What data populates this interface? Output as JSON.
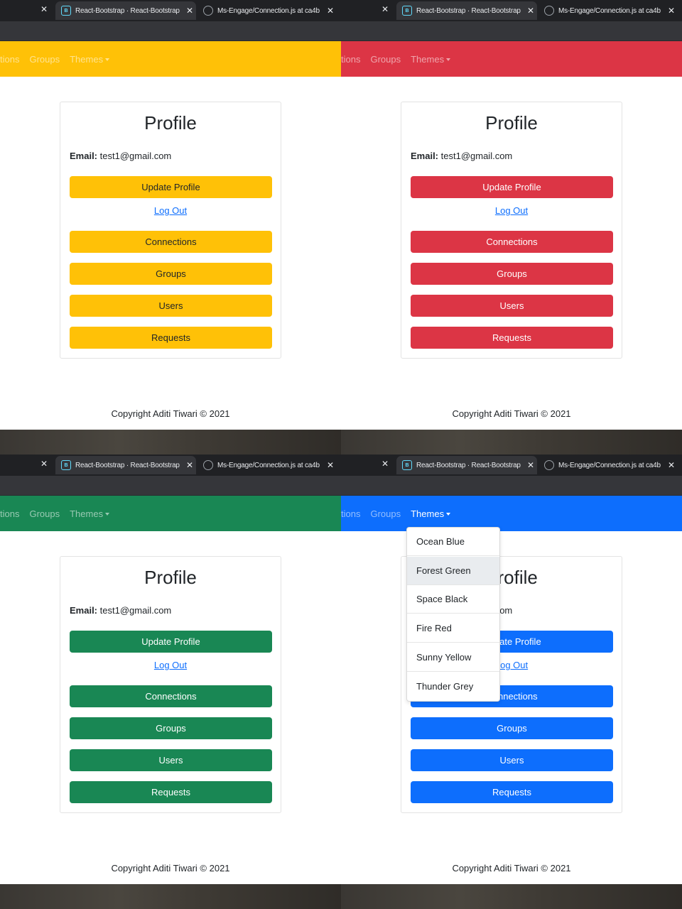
{
  "browser": {
    "tab1_title": "React-Bootstrap · React-Bootstrap",
    "tab2_title": "Ms-Engage/Connection.js at ca4b",
    "tab1_favicon": "react-bootstrap-icon",
    "tab2_favicon": "github-icon"
  },
  "nav": {
    "link_connections": "tions",
    "link_groups": "Groups",
    "link_themes": "Themes"
  },
  "profile": {
    "title": "Profile",
    "email_label": "Email:",
    "email_value": "test1@gmail.com",
    "update_button": "Update Profile",
    "logout_link": "Log Out",
    "connections_button": "Connections",
    "groups_button": "Groups",
    "users_button": "Users",
    "requests_button": "Requests"
  },
  "footer": {
    "copyright": "Copyright Aditi Tiwari © 2021"
  },
  "themes_dropdown": {
    "items": [
      "Ocean Blue",
      "Forest Green",
      "Space Black",
      "Fire Red",
      "Sunny Yellow",
      "Thunder Grey"
    ],
    "hovered": "Forest Green"
  },
  "panels": [
    {
      "theme": "Sunny Yellow",
      "color": "#ffc107",
      "text_color": "#212529",
      "dropdown_open": false
    },
    {
      "theme": "Fire Red",
      "color": "#dc3545",
      "text_color": "#ffffff",
      "dropdown_open": false
    },
    {
      "theme": "Forest Green",
      "color": "#198754",
      "text_color": "#ffffff",
      "dropdown_open": false
    },
    {
      "theme": "Ocean Blue",
      "color": "#0d6efd",
      "text_color": "#ffffff",
      "dropdown_open": true
    }
  ]
}
